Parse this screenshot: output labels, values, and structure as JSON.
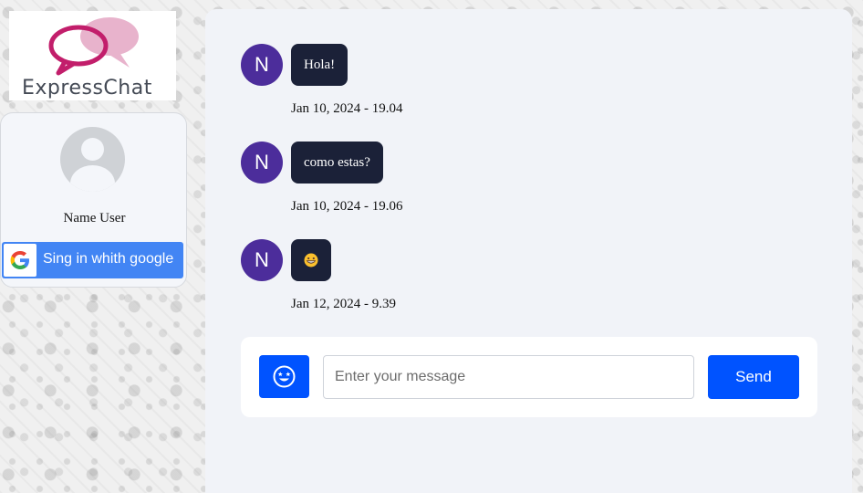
{
  "brand": {
    "name": "ExpressChat",
    "accent_color": "#c21e6b",
    "light_accent_color": "#e8b3cc"
  },
  "user": {
    "name": "Name User",
    "avatar_icon": "user-placeholder-icon"
  },
  "auth": {
    "google_label": "Sing in whith google",
    "google_icon": "google-g-icon",
    "button_color": "#4285f4"
  },
  "messages": [
    {
      "avatar_initial": "N",
      "text": "Hola!",
      "time": "Jan 10, 2024 - 19.04"
    },
    {
      "avatar_initial": "N",
      "text": "como estas?",
      "time": "Jan 10, 2024 - 19.06"
    },
    {
      "avatar_initial": "N",
      "text": "",
      "emoji": "grinning-face-icon",
      "time": "Jan 12, 2024 - 9.39"
    }
  ],
  "composer": {
    "placeholder": "Enter your message",
    "value": "",
    "send_label": "Send",
    "emoji_icon": "smiley-face-icon",
    "button_color": "#0053ff"
  },
  "colors": {
    "avatar_bg": "#4c2d9b",
    "bubble_bg": "#1b2138",
    "panel_bg": "#f1f3f8"
  }
}
